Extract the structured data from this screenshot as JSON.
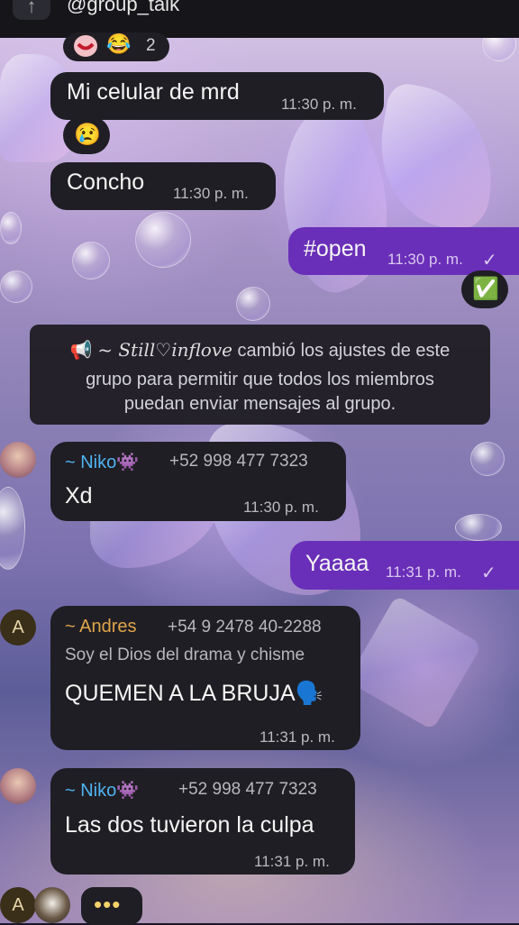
{
  "header": {
    "back_icon": "pin-icon",
    "handle": "@group_talk"
  },
  "reactions_top": {
    "emojis": [
      "heart-face",
      "laughing-emoji"
    ],
    "laugh_glyph": "😂",
    "count": "2"
  },
  "messages": [
    {
      "text": "Mi celular de mrd",
      "time": "11:30 p. m.",
      "direction": "in"
    },
    {
      "reaction": "😢"
    },
    {
      "text": "Concho",
      "time": "11:30 p. m.",
      "direction": "in"
    },
    {
      "text": "#open",
      "time": "11:30 p. m.",
      "direction": "out",
      "status": "✓"
    },
    {
      "reaction": "✅"
    }
  ],
  "system": {
    "icon": "megaphone-icon",
    "actor": "~ Still♡inflove",
    "line1_rest": " cambió los ajustes de este",
    "line2": "grupo para permitir que todos los miembros",
    "line3": "puedan enviar mensajes al grupo."
  },
  "niko1": {
    "name": "~ Niko👾",
    "phone": "+52 998 477 7323",
    "text": "Xd",
    "time": "11:30 p. m."
  },
  "out2": {
    "text": "Yaaaa",
    "time": "11:31 p. m.",
    "status": "✓"
  },
  "andres": {
    "avatar": "A",
    "name": "~ Andres",
    "phone": "+54 9 2478 40-2288",
    "subtitle": "Soy el Dios del drama y chisme",
    "text": "QUEMEN A LA BRUJA🗣️",
    "time": "11:31 p. m."
  },
  "niko2": {
    "name": "~ Niko👾",
    "phone": "+52 998 477 7323",
    "text": "Las dos tuvieron la culpa",
    "time": "11:31 p. m."
  },
  "typing": {
    "avatar": "A",
    "dots": "•••"
  },
  "colors": {
    "incoming_bubble": "#1f1e24",
    "outgoing_bubble": "#6a2fb8",
    "niko_name": "#4fb3f0",
    "andres_name": "#e0a54a",
    "topbar": "#15151a"
  }
}
